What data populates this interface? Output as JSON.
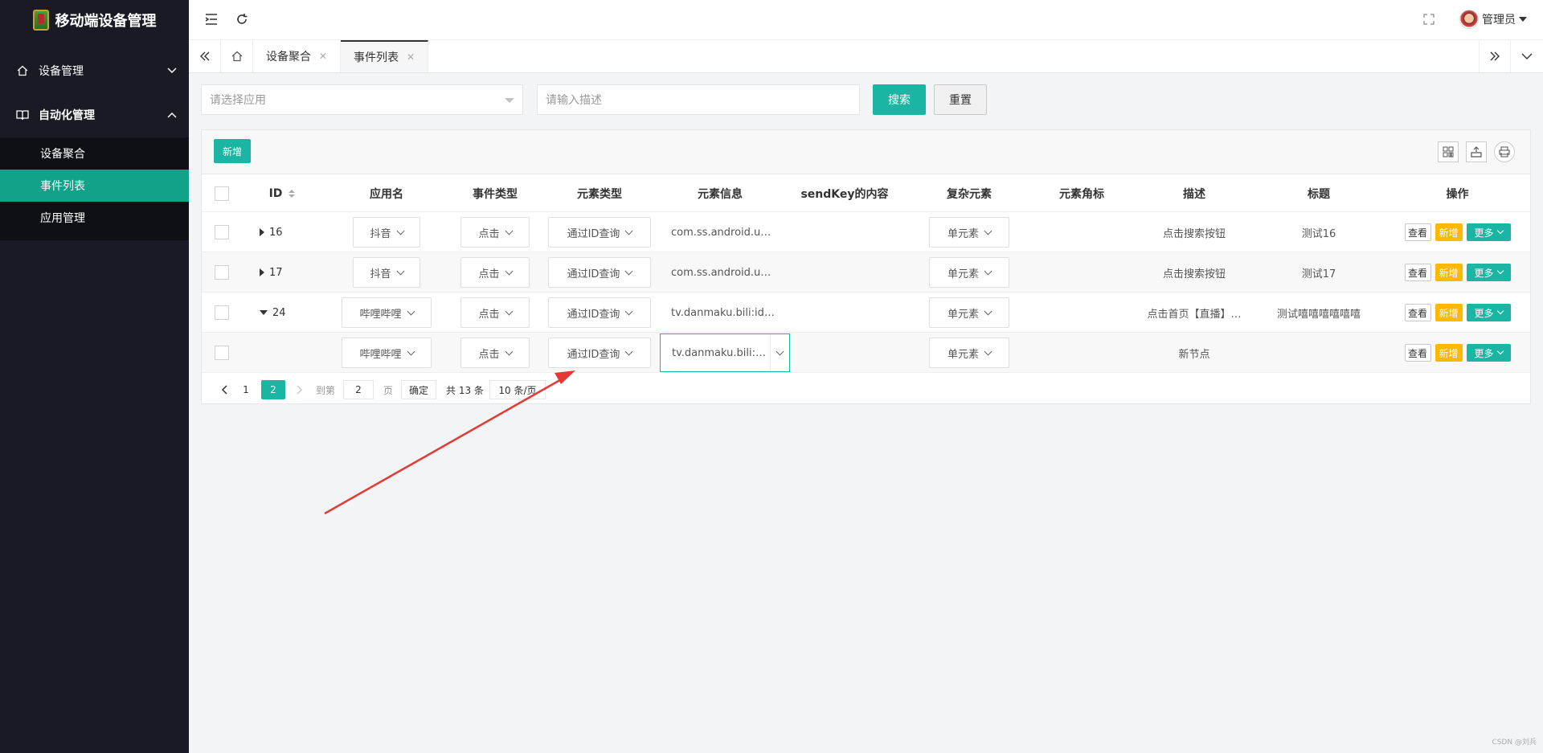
{
  "app": {
    "title": "移动端设备管理"
  },
  "sidebar": {
    "menus": [
      {
        "label": "设备管理",
        "expanded": false
      },
      {
        "label": "自动化管理",
        "expanded": true
      }
    ],
    "submenu": [
      {
        "label": "设备聚合",
        "active": false
      },
      {
        "label": "事件列表",
        "active": true
      },
      {
        "label": "应用管理",
        "active": false
      }
    ]
  },
  "header": {
    "user": "管理员"
  },
  "tabs": [
    {
      "label": "设备聚合",
      "active": false
    },
    {
      "label": "事件列表",
      "active": true
    }
  ],
  "filter": {
    "app_placeholder": "请选择应用",
    "desc_placeholder": "请输入描述",
    "search_label": "搜索",
    "reset_label": "重置"
  },
  "toolbar": {
    "add_label": "新增"
  },
  "table": {
    "columns": [
      "ID",
      "应用名",
      "事件类型",
      "元素类型",
      "元素信息",
      "sendKey的内容",
      "复杂元素",
      "元素角标",
      "描述",
      "标题",
      "操作"
    ],
    "rows": [
      {
        "id": "16",
        "expand": "collapsed",
        "app": "抖音",
        "event": "点击",
        "etype": "通过ID查询",
        "info": "com.ss.android.ug…",
        "sendkey": "",
        "complex": "单元素",
        "badge": "",
        "desc": "点击搜索按钮",
        "title": "测试16"
      },
      {
        "id": "17",
        "expand": "collapsed",
        "app": "抖音",
        "event": "点击",
        "etype": "通过ID查询",
        "info": "com.ss.android.ug…",
        "sendkey": "",
        "complex": "单元素",
        "badge": "",
        "desc": "点击搜索按钮",
        "title": "测试17"
      },
      {
        "id": "24",
        "expand": "expanded",
        "app": "哔哩哔哩",
        "event": "点击",
        "etype": "通过ID查询",
        "info": "tv.danmaku.bili:id/t…",
        "sendkey": "",
        "complex": "单元素",
        "badge": "",
        "desc": "点击首页【直播】…",
        "title": "测试嘻嘻嘻嘻嘻嘻"
      },
      {
        "id": "",
        "expand": "none",
        "app": "哔哩哔哩",
        "event": "点击",
        "etype": "通过ID查询",
        "info": "tv.danmaku.bili:id/t…",
        "sendkey": "",
        "complex": "单元素",
        "badge": "",
        "desc": "新节点",
        "title": ""
      }
    ],
    "ops": {
      "view": "查看",
      "add": "新增",
      "more": "更多"
    }
  },
  "pager": {
    "pages": [
      "1",
      "2"
    ],
    "current": "2",
    "goto_label": "到第",
    "goto_value": "2",
    "page_unit": "页",
    "confirm": "确定",
    "total": "共 13 条",
    "per_page": "10 条/页"
  },
  "watermark": "CSDN @刘兵",
  "colors": {
    "accent": "#1ab5a3",
    "warning": "#ffb800",
    "sidebar": "#191a23",
    "arrow": "#e53935"
  }
}
